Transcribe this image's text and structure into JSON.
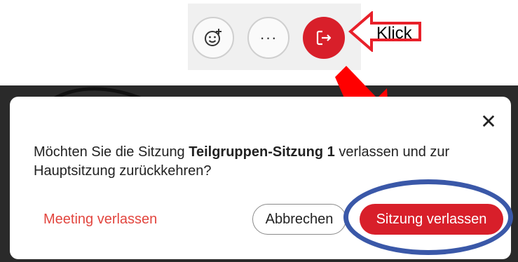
{
  "toolbar": {
    "buttons": [
      {
        "icon": "emoji-reaction-icon"
      },
      {
        "icon": "more-options-icon",
        "label": "···"
      },
      {
        "icon": "leave-session-icon",
        "color": "#d81f2a"
      }
    ]
  },
  "callout": {
    "label": "Klick",
    "color": "#e8202a"
  },
  "dialog": {
    "close_label": "✕",
    "message_before": "Möchten Sie die Sitzung ",
    "message_bold": "Teilgruppen-Sitzung 1",
    "message_after": " verlassen und zur Hauptsitzung zurückkehren?",
    "meeting_leave_label": "Meeting verlassen",
    "cancel_label": "Abbrechen",
    "leave_session_label": "Sitzung verlassen"
  },
  "colors": {
    "accent_red": "#d81f2a",
    "link_red": "#e2453e",
    "highlight_blue": "#3a58a8"
  }
}
